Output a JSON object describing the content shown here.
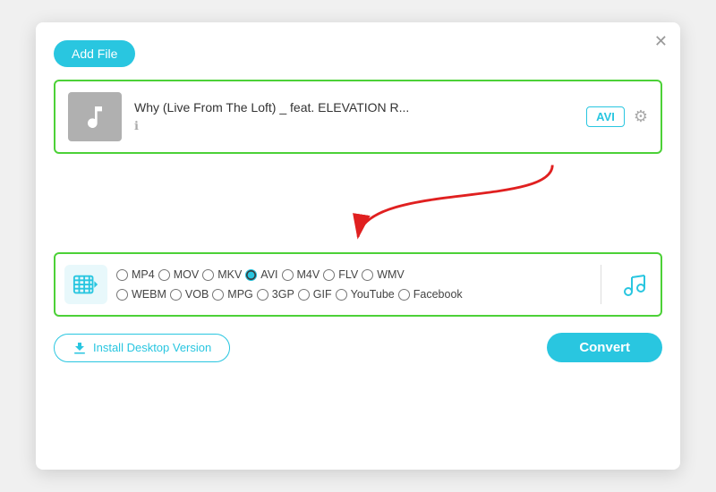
{
  "dialog": {
    "close_label": "✕"
  },
  "toolbar": {
    "add_file_label": "Add File"
  },
  "file_card": {
    "title": "Why (Live From The Loft) _ feat. ELEVATION R...",
    "format_badge": "AVI",
    "info_icon": "ℹ"
  },
  "format_selector": {
    "formats_row1": [
      {
        "id": "mp4",
        "label": "MP4",
        "checked": false
      },
      {
        "id": "mov",
        "label": "MOV",
        "checked": false
      },
      {
        "id": "mkv",
        "label": "MKV",
        "checked": false
      },
      {
        "id": "avi",
        "label": "AVI",
        "checked": true
      },
      {
        "id": "m4v",
        "label": "M4V",
        "checked": false
      },
      {
        "id": "flv",
        "label": "FLV",
        "checked": false
      },
      {
        "id": "wmv",
        "label": "WMV",
        "checked": false
      }
    ],
    "formats_row2": [
      {
        "id": "webm",
        "label": "WEBM",
        "checked": false
      },
      {
        "id": "vob",
        "label": "VOB",
        "checked": false
      },
      {
        "id": "mpg",
        "label": "MPG",
        "checked": false
      },
      {
        "id": "3gp",
        "label": "3GP",
        "checked": false
      },
      {
        "id": "gif",
        "label": "GIF",
        "checked": false
      },
      {
        "id": "youtube",
        "label": "YouTube",
        "checked": false
      },
      {
        "id": "facebook",
        "label": "Facebook",
        "checked": false
      }
    ]
  },
  "bottom_bar": {
    "install_label": "Install Desktop Version",
    "convert_label": "Convert"
  },
  "colors": {
    "accent": "#29c6e0",
    "green_border": "#4cd137",
    "arrow_red": "#e02020"
  }
}
